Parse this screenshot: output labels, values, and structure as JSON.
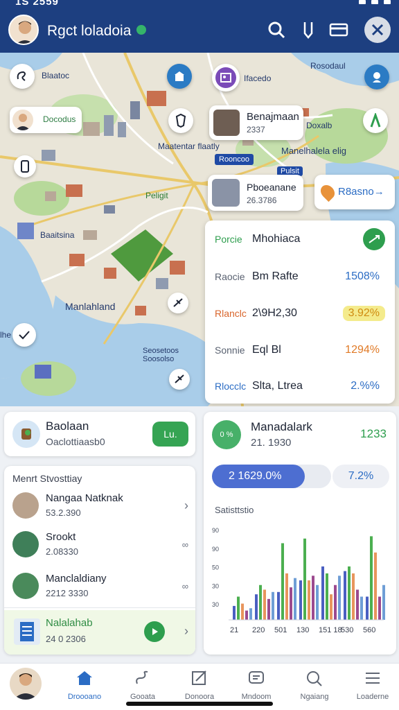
{
  "status_bar": {
    "time": "1S 2559"
  },
  "header": {
    "title": "Rgct loladoia",
    "avatar": "user-avatar",
    "actions": [
      "search-person-icon",
      "pen-icon",
      "card-icon",
      "close-icon"
    ]
  },
  "map": {
    "labels": {
      "tl_road": "Blaatoc",
      "top_center": "Ifacedo",
      "top_right": "Rosodaul",
      "user_chip": "Docodus",
      "right_upper": "Doxalb",
      "central": "Maatentar flaatly",
      "central_right": "Manelhalela elig",
      "road_sign_a": "Rooncoo",
      "road_sign_b": "Pulsit",
      "park": "Peligit",
      "west": "Baaitsina",
      "harbor": "Manlahland",
      "south": "Seosetoos Soosolso",
      "far_left": "lhe"
    },
    "place_card_1": {
      "title": "Benajmaan",
      "sub": "2337"
    },
    "place_card_2": {
      "title": "Pboeanane",
      "sub": "26.3786"
    },
    "search_chip": "R8asno→",
    "colors": {
      "water": "#a9cde9",
      "land": "#e9e5d8",
      "park": "#b7d99a",
      "road": "#e9c86a"
    }
  },
  "stats_card": {
    "rows": [
      {
        "key": "Porcie",
        "name": "Mhohiaca",
        "value": "",
        "key_color": "#2e9e4e"
      },
      {
        "key": "Raocie",
        "name": "Bm Rafte",
        "value": "1508%",
        "key_color": "#5a6271",
        "value_color": "#2b6cc4",
        "value_bg": ""
      },
      {
        "key": "Rlanclc",
        "name": "2\\9H2,30",
        "value": "3.92%",
        "key_color": "#d9652b",
        "value_color": "#d08b10",
        "value_bg": "#f4eb8c"
      },
      {
        "key": "Sonnie",
        "name": "Eql Bl",
        "value": "1294%",
        "key_color": "#5a6271",
        "value_color": "#e07a26",
        "value_bg": ""
      },
      {
        "key": "Rlocclc",
        "name": "Slta, Ltrea",
        "value": "2.%%",
        "key_color": "#2b6cc4",
        "value_color": "#2b6cc4",
        "value_bg": ""
      }
    ]
  },
  "left_panel": {
    "card": {
      "title": "Baolaan",
      "sub": "Oaclottiaasb0",
      "button": "Lu."
    },
    "list_title": "Menrt Stvosttiay",
    "items": [
      {
        "title": "Nangaa Natknak",
        "sub": "53.2.390",
        "icon": "chevron-right-icon"
      },
      {
        "title": "Srookt",
        "sub": "2.08330",
        "icon": "link-icon"
      },
      {
        "title": "Manclaldiany",
        "sub": "2212 3330",
        "icon": "link-icon"
      },
      {
        "title": "Nalalahab",
        "sub": "24 0 2306",
        "icon": "chevron-right-icon"
      }
    ]
  },
  "right_panel": {
    "title": "Manadalark",
    "sub": "21. 1930",
    "value": "1233",
    "progress_label": "2 1629.0%",
    "progress_side": "7.2%",
    "progress_fraction": 0.78,
    "chart_title": "Satisttstio"
  },
  "chart_data": {
    "type": "bar",
    "title": "Satisttstio",
    "y_tick_labels": [
      "90",
      "90",
      "50",
      "30",
      "30"
    ],
    "x_tick_labels": [
      "21",
      "220",
      "501",
      "130",
      "151 18",
      "530",
      "560"
    ],
    "series": [
      {
        "color": "#4a5fc1",
        "values": [
          12,
          22,
          24,
          34,
          46,
          42,
          20
        ]
      },
      {
        "color": "#4caf50",
        "values": [
          20,
          30,
          66,
          70,
          40,
          46,
          72
        ]
      },
      {
        "color": "#e8955d",
        "values": [
          14,
          26,
          40,
          34,
          22,
          40,
          58
        ]
      },
      {
        "color": "#9c4a8f",
        "values": [
          8,
          18,
          28,
          38,
          30,
          26,
          20
        ]
      },
      {
        "color": "#6f9ed6",
        "values": [
          10,
          24,
          36,
          30,
          38,
          20,
          30
        ]
      }
    ]
  },
  "bottom_nav": {
    "items": [
      {
        "label": "Droooano",
        "icon": "home-icon",
        "active": true
      },
      {
        "label": "Gooata",
        "icon": "route-icon"
      },
      {
        "label": "Donoora",
        "icon": "edit-icon"
      },
      {
        "label": "Mndoom",
        "icon": "chat-icon"
      },
      {
        "label": "Ngaiang",
        "icon": "search-icon"
      },
      {
        "label": "Loaderne",
        "icon": "list-icon"
      }
    ]
  }
}
